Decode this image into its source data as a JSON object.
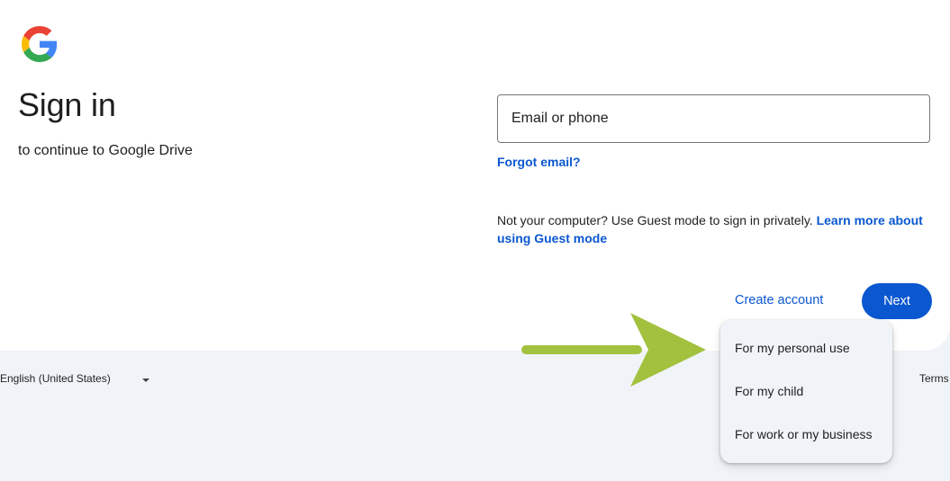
{
  "header": {
    "logo_icon": "google-g-icon",
    "title": "Sign in",
    "subtitle": "to continue to Google Drive"
  },
  "form": {
    "email_placeholder": "Email or phone",
    "forgot_email": "Forgot email?",
    "guest_text": "Not your computer? Use Guest mode to sign in privately.",
    "guest_link": "Learn more about using Guest mode",
    "create_account": "Create account",
    "next": "Next"
  },
  "menu": {
    "items": [
      {
        "label": "For my personal use"
      },
      {
        "label": "For my child"
      },
      {
        "label": "For work or my business"
      }
    ]
  },
  "footer": {
    "language": "English (United States)",
    "terms": "Terms"
  },
  "annotation": {
    "arrow_color": "#a2c13e"
  },
  "colors": {
    "accent": "#0b57d0",
    "background": "#f0f4f9"
  }
}
